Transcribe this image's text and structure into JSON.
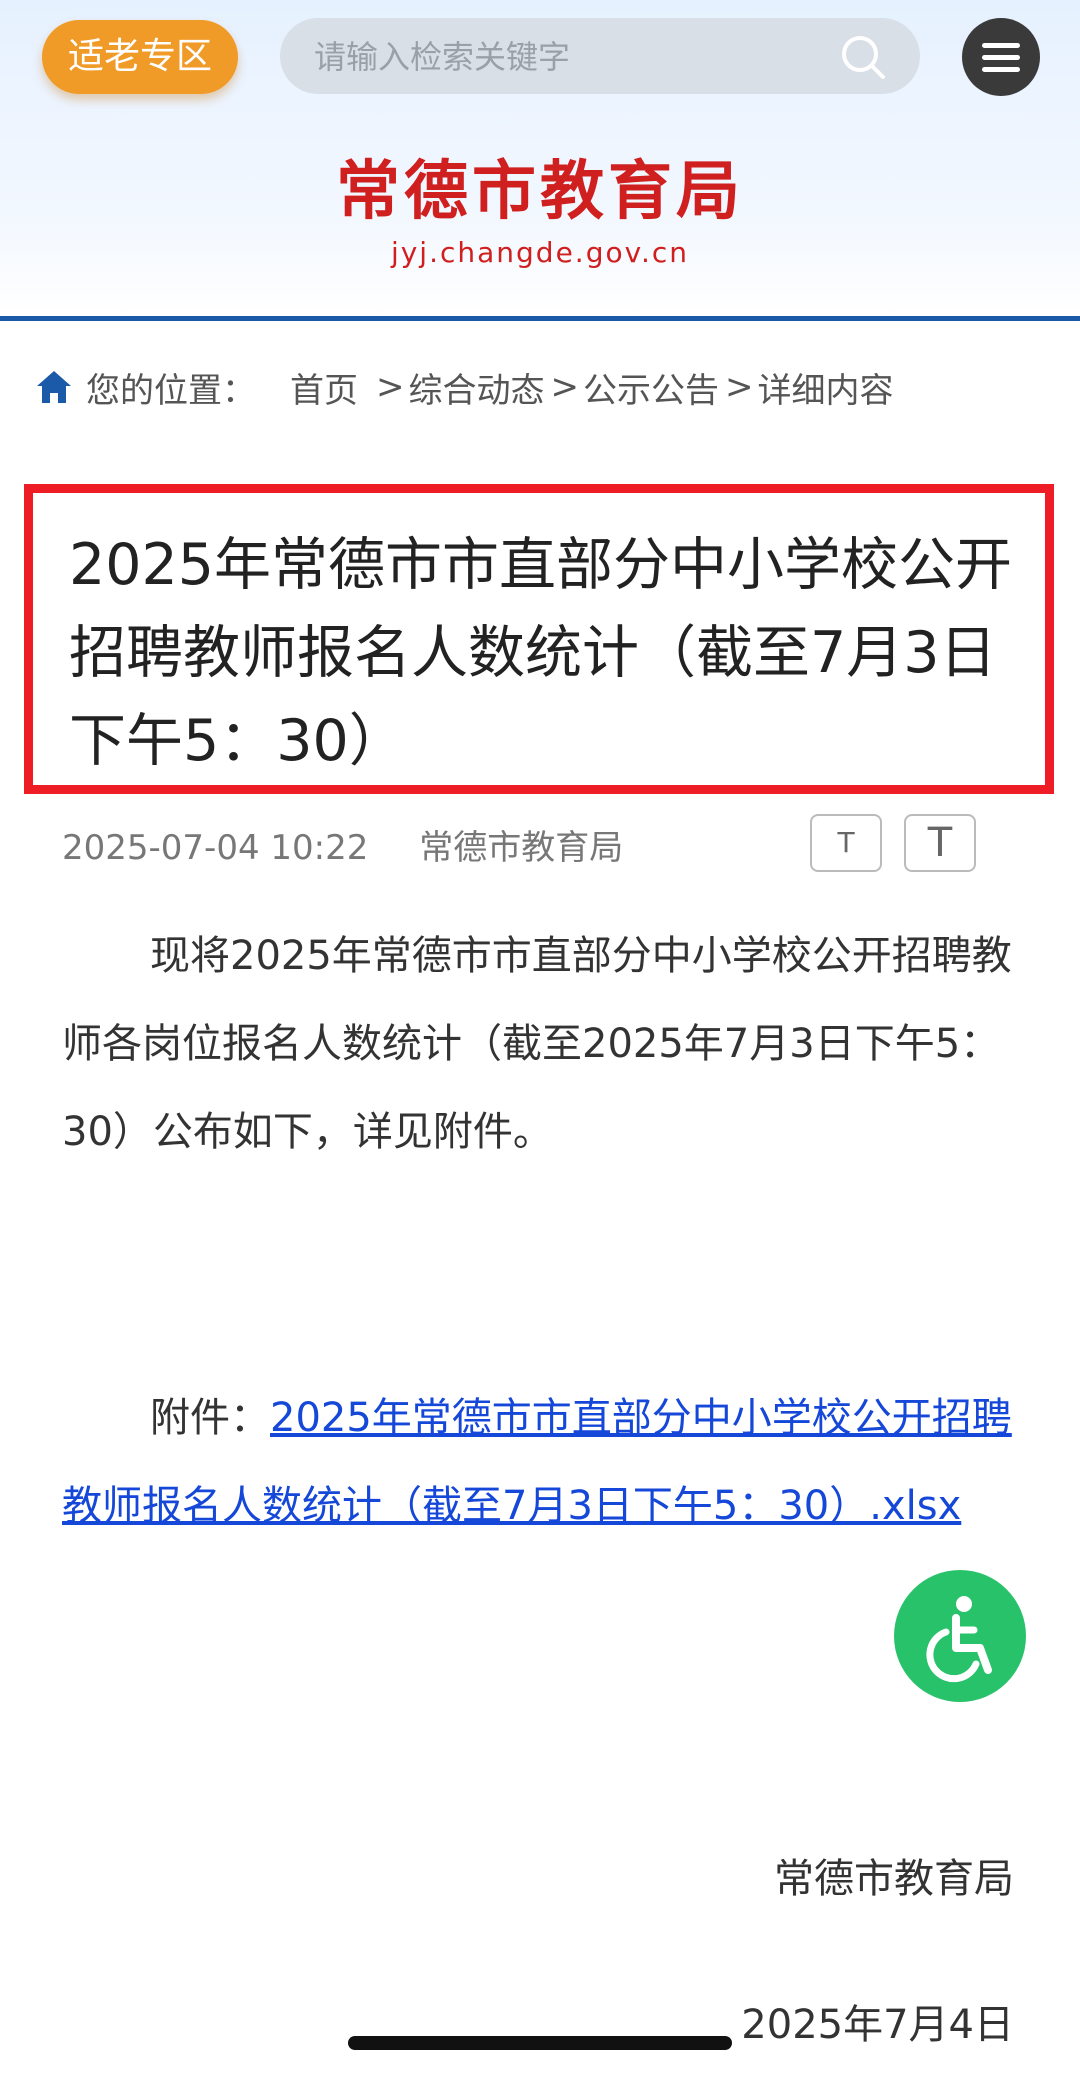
{
  "header": {
    "elder_zone_label": "适老专区",
    "search_placeholder": "请输入检索关键字",
    "site_title": "常德市教育局",
    "site_domain": "jyj.changde.gov.cn"
  },
  "breadcrumb": {
    "prefix": "您的位置：",
    "items": [
      "首页",
      "综合动态",
      "公示公告",
      "详细内容"
    ]
  },
  "article": {
    "title": "2025年常德市市直部分中小学校公开招聘教师报名人数统计（截至7月3日下午5：30）",
    "date": "2025-07-04 10:22",
    "author": "常德市教育局",
    "font_small_label": "T",
    "font_large_label": "T",
    "body": "现将2025年常德市市直部分中小学校公开招聘教师各岗位报名人数统计（截至2025年7月3日下午5：30）公布如下，详见附件。",
    "attachment_prefix": "附件：",
    "attachment_link": "2025年常德市市直部分中小学校公开招聘教师报名人数统计（截至7月3日下午5：30）.xlsx",
    "signature": "常德市教育局",
    "sign_date": "2025年7月4日"
  },
  "colors": {
    "brand_red": "#d01f1f",
    "highlight_box": "#ee1c24",
    "link_blue": "#1547d8",
    "accessibility_green": "#27c26a",
    "elder_orange": "#f09a27"
  }
}
